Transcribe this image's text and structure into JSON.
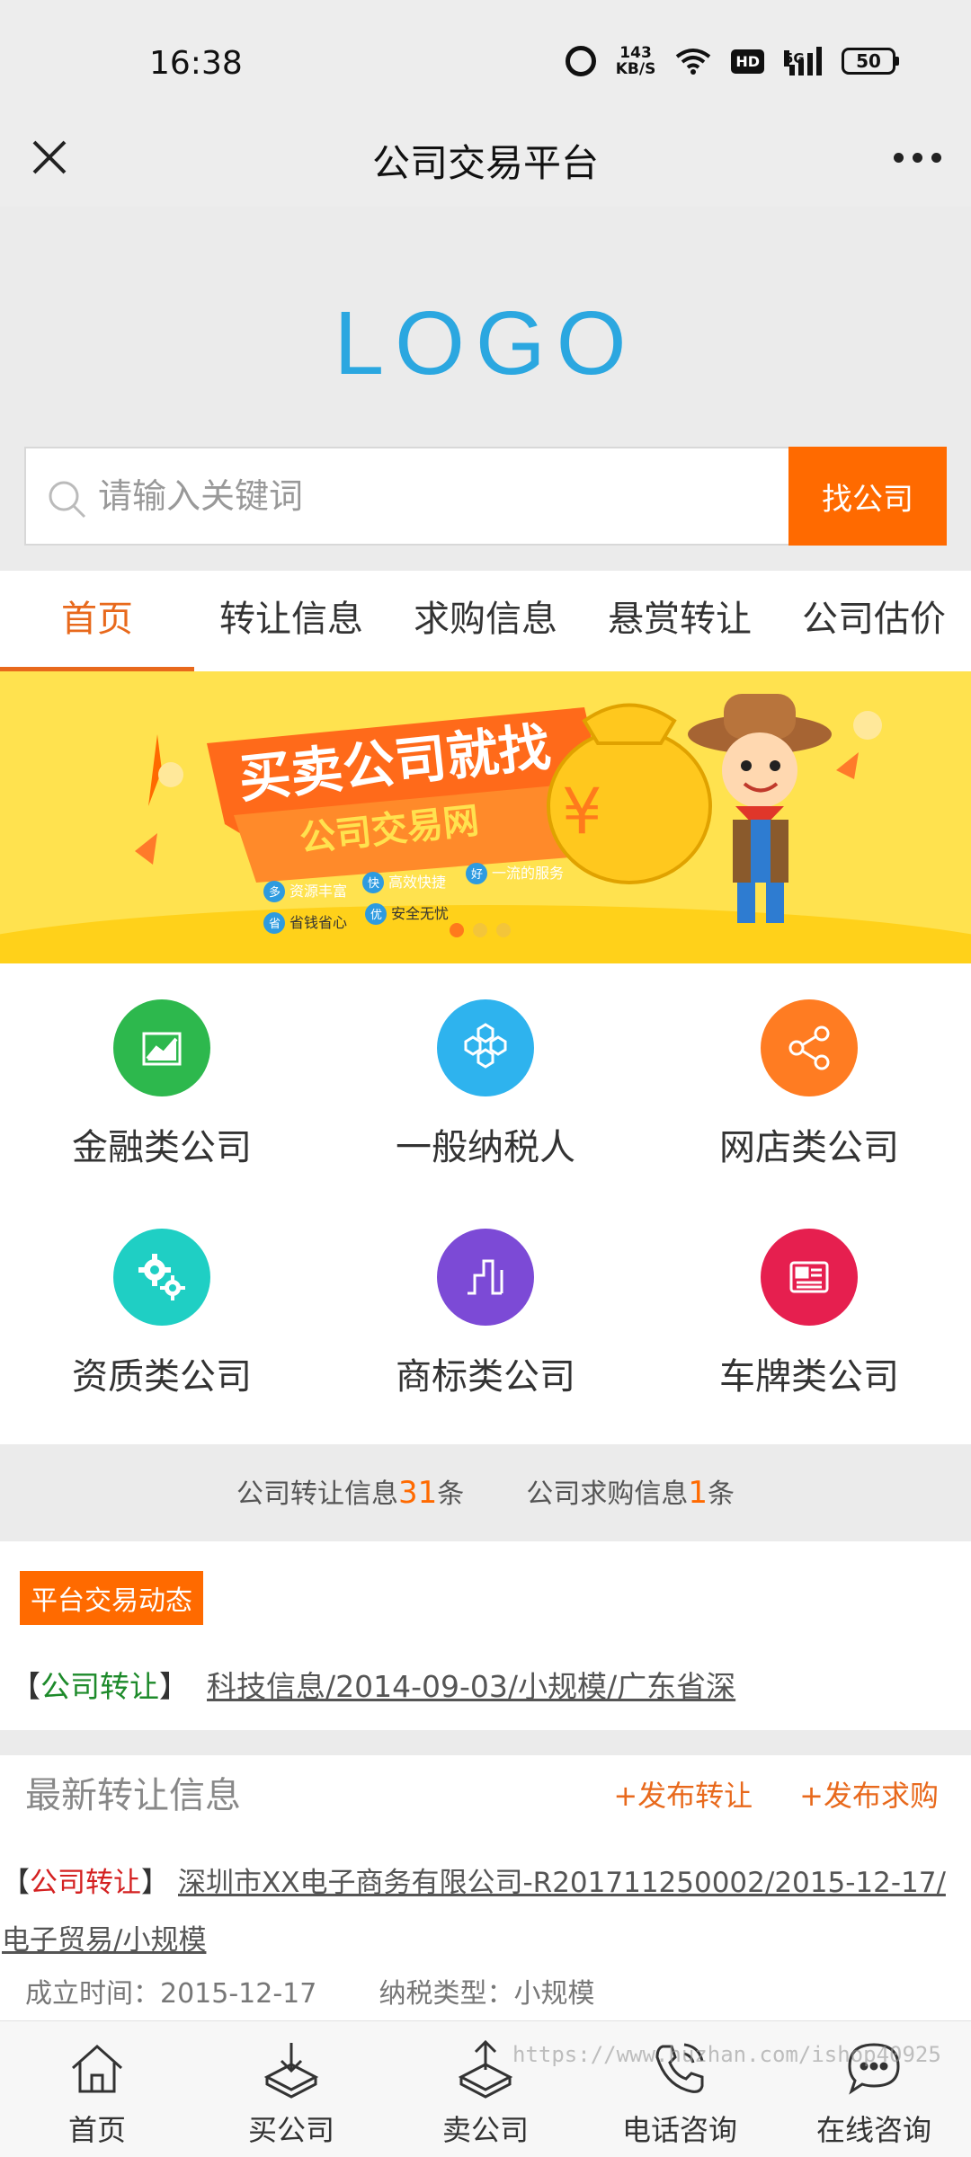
{
  "status_bar": {
    "time": "16:38",
    "speed_value": "143",
    "speed_unit": "KB/S",
    "network": "5G",
    "hd": "HD",
    "battery": "50"
  },
  "header": {
    "title": "公司交易平台"
  },
  "logo": {
    "text": "LOGO",
    "color": "#2ba7e0"
  },
  "search": {
    "placeholder": "请输入关键词",
    "button_label": "找公司"
  },
  "nav_tabs": [
    {
      "label": "首页",
      "active": true
    },
    {
      "label": "转让信息"
    },
    {
      "label": "求购信息"
    },
    {
      "label": "悬赏转让"
    },
    {
      "label": "公司估价"
    }
  ],
  "banner": {
    "headline": "买卖公司就找",
    "subheadline": "公司交易网",
    "features": [
      "资源丰富",
      "高效快捷",
      "一流的服务",
      "省钱省心",
      "安全无忧"
    ],
    "feature_badges": [
      "多",
      "快",
      "好",
      "省",
      "优"
    ],
    "coin_symbol": "¥"
  },
  "categories": [
    {
      "label": "金融类公司",
      "color": "#2db84d",
      "icon": "chart-up-icon"
    },
    {
      "label": "一般纳税人",
      "color": "#2eb3ee",
      "icon": "hexagon-cluster-icon"
    },
    {
      "label": "网店类公司",
      "color": "#ff7c22",
      "icon": "share-icon"
    },
    {
      "label": "资质类公司",
      "color": "#1fcfc4",
      "icon": "gears-icon"
    },
    {
      "label": "商标类公司",
      "color": "#7c4ad6",
      "icon": "bar-chart-icon"
    },
    {
      "label": "车牌类公司",
      "color": "#e61f4f",
      "icon": "newspaper-icon"
    }
  ],
  "stats": {
    "transfer_prefix": "公司转让信息",
    "transfer_count": "31",
    "transfer_suffix": "条",
    "purchase_prefix": "公司求购信息",
    "purchase_count": "1",
    "purchase_suffix": "条"
  },
  "dynamics": {
    "badge": "平台交易动态",
    "bracket_open": "【",
    "tag": "公司转让",
    "bracket_close": "】",
    "link": "科技信息/2014-09-03/小规模/广东省深"
  },
  "latest": {
    "title": "最新转让信息",
    "publish_transfer": "+发布转让",
    "publish_purchase": "+发布求购",
    "bracket_open": "【",
    "tag": "公司转让",
    "bracket_close": "】",
    "link": "深圳市XX电子商务有限公司-R201711250002/2015-12-17/电子贸易/小规模",
    "established_label": "成立时间：",
    "established_value": "2015-12-17",
    "tax_label": "纳税类型：",
    "tax_value": "小规模"
  },
  "bottom_nav": [
    {
      "label": "首页",
      "icon": "home-icon"
    },
    {
      "label": "买公司",
      "icon": "download-tray-icon"
    },
    {
      "label": "卖公司",
      "icon": "upload-tray-icon"
    },
    {
      "label": "电话咨询",
      "icon": "phone-icon"
    },
    {
      "label": "在线咨询",
      "icon": "chat-icon"
    }
  ],
  "watermark": "https://www.huzhan.com/ishop40925",
  "colors": {
    "accent": "#ff6a00",
    "tab_active": "#e8691c",
    "banner_bg": "#ffe24f"
  }
}
